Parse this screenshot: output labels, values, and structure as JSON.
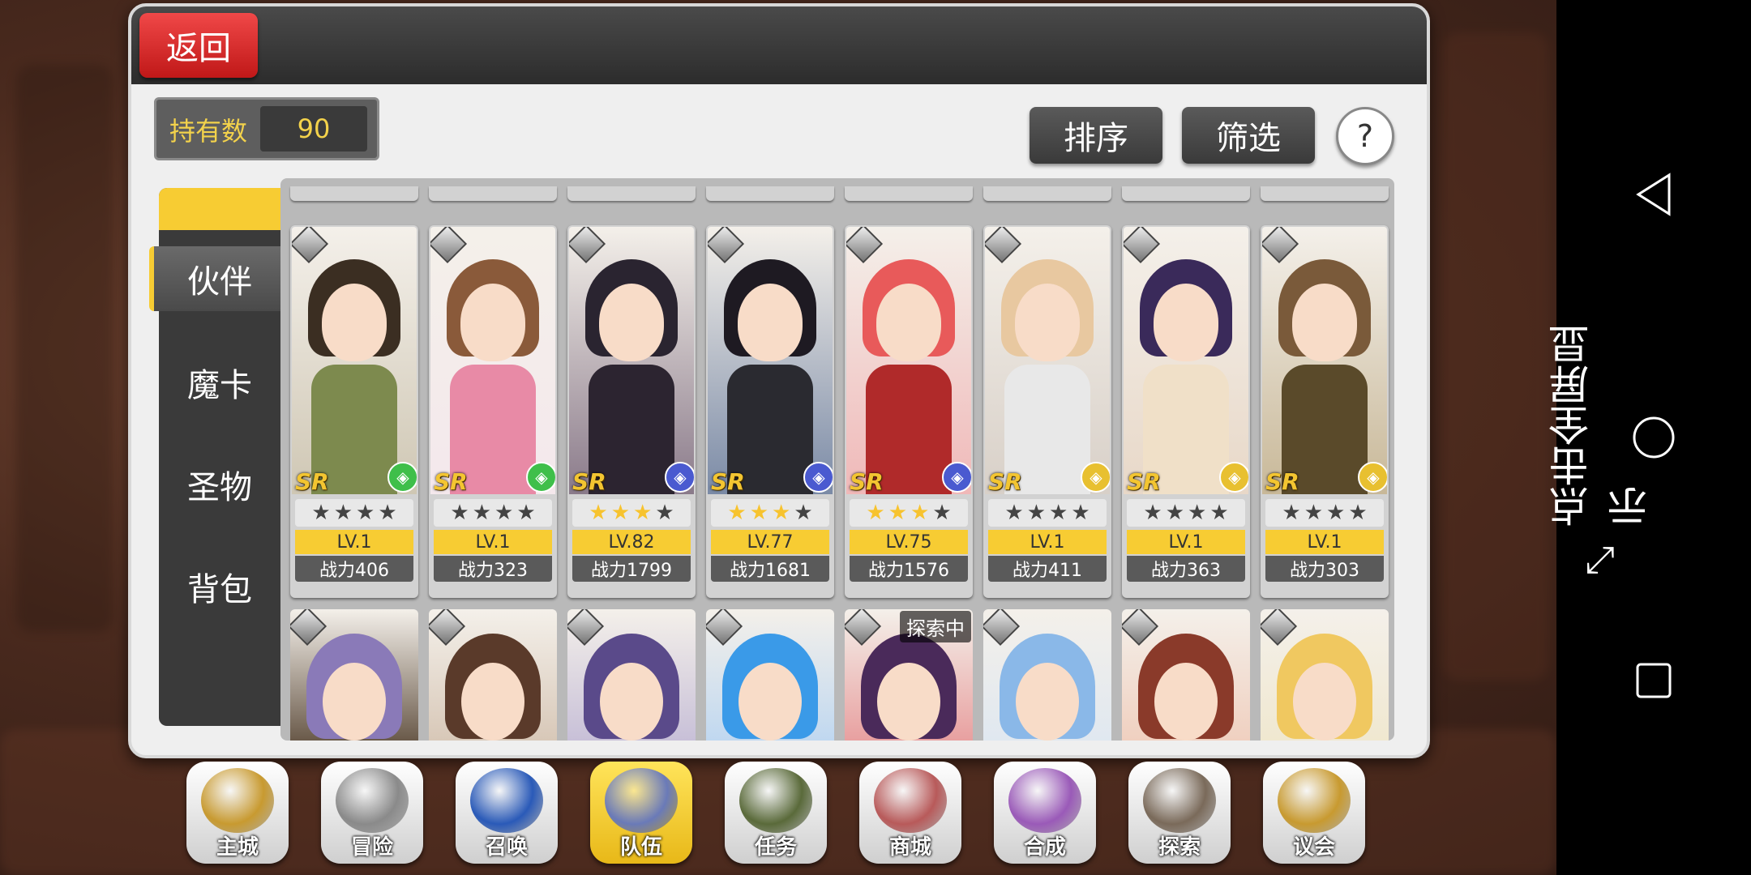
{
  "header": {
    "back_label": "返回"
  },
  "inventory": {
    "count_label": "持有数",
    "count_value": "90"
  },
  "toolbar": {
    "sort_label": "排序",
    "filter_label": "筛选",
    "help_label": "?"
  },
  "side_nav": {
    "items": [
      {
        "label": "伙伴",
        "active": true
      },
      {
        "label": "魔卡",
        "active": false
      },
      {
        "label": "圣物",
        "active": false
      },
      {
        "label": "背包",
        "active": false
      }
    ]
  },
  "cards": [
    {
      "rarity": "SR",
      "stars": 0,
      "level": "LV.1",
      "power": "战力406",
      "hair": "#3b2e22",
      "outfit": "#7d8a4e",
      "bg": "#cfc7b4",
      "type_color": "#3fbf4a",
      "type_icon": "bow-icon"
    },
    {
      "rarity": "SR",
      "stars": 0,
      "level": "LV.1",
      "power": "战力323",
      "hair": "#8a5a3a",
      "outfit": "#e88aa6",
      "bg": "#f4e8ec",
      "type_color": "#3fbf4a",
      "type_icon": "bow-icon"
    },
    {
      "rarity": "SR",
      "stars": 3,
      "level": "LV.82",
      "power": "战力1799",
      "hair": "#2a2430",
      "outfit": "#2c2430",
      "bg": "#8a7a8a",
      "type_color": "#4a5ad0",
      "type_icon": "shield-icon"
    },
    {
      "rarity": "SR",
      "stars": 3,
      "level": "LV.77",
      "power": "战力1681",
      "hair": "#1e1a22",
      "outfit": "#2a2a30",
      "bg": "#7a8aa6",
      "type_color": "#4a5ad0",
      "type_icon": "staff-icon"
    },
    {
      "rarity": "SR",
      "stars": 3,
      "level": "LV.75",
      "power": "战力1576",
      "hair": "#e85a5a",
      "outfit": "#b02a2a",
      "bg": "#f0b8b8",
      "type_color": "#4a5ad0",
      "type_icon": "scythe-icon"
    },
    {
      "rarity": "SR",
      "stars": 0,
      "level": "LV.1",
      "power": "战力411",
      "hair": "#e8c8a0",
      "outfit": "#e8e8e8",
      "bg": "#d8d0c8",
      "type_color": "#e8c030",
      "type_icon": "fist-icon"
    },
    {
      "rarity": "SR",
      "stars": 0,
      "level": "LV.1",
      "power": "战力363",
      "hair": "#3a2a5a",
      "outfit": "#f0e0c8",
      "bg": "#e8d8c8",
      "type_color": "#e8c030",
      "type_icon": "sword-icon"
    },
    {
      "rarity": "SR",
      "stars": 0,
      "level": "LV.1",
      "power": "战力303",
      "hair": "#7a5a3a",
      "outfit": "#5a4a2a",
      "bg": "#c8b898",
      "type_color": "#e8c030",
      "type_icon": "shield-icon"
    }
  ],
  "cards_row2": [
    {
      "hair": "#8a7ab8",
      "bg": "#6a5a4a",
      "tag": ""
    },
    {
      "hair": "#5a3a2a",
      "bg": "#d8c8b8",
      "tag": ""
    },
    {
      "hair": "#5a4a8a",
      "bg": "#c8c0d8",
      "tag": ""
    },
    {
      "hair": "#3a9ae8",
      "bg": "#c0d8f0",
      "tag": ""
    },
    {
      "hair": "#4a2a5a",
      "bg": "#e8a0a0",
      "tag": "探索中"
    },
    {
      "hair": "#8ab8e8",
      "bg": "#e0e8f0",
      "tag": ""
    },
    {
      "hair": "#8a3a2a",
      "bg": "#f0d0c0",
      "tag": ""
    },
    {
      "hair": "#f0c860",
      "bg": "#f0e8d0",
      "tag": ""
    }
  ],
  "bottom_nav": [
    {
      "label": "主城",
      "icon": "crown-icon",
      "color": "#c89a30"
    },
    {
      "label": "冒险",
      "icon": "crossed-swords-icon",
      "color": "#8a8a8a"
    },
    {
      "label": "召唤",
      "icon": "summon-card-icon",
      "color": "#2a5ab8"
    },
    {
      "label": "队伍",
      "icon": "winged-emblem-icon",
      "color": "#6a7ab8",
      "active": true
    },
    {
      "label": "任务",
      "icon": "quest-book-icon",
      "color": "#5a6a3a"
    },
    {
      "label": "商城",
      "icon": "shop-tree-icon",
      "color": "#b85a5a"
    },
    {
      "label": "合成",
      "icon": "potion-icon",
      "color": "#9a5ab8"
    },
    {
      "label": "探索",
      "icon": "explore-bow-icon",
      "color": "#7a6a5a"
    },
    {
      "label": "议会",
      "icon": "council-crest-icon",
      "color": "#c89a30"
    }
  ],
  "system": {
    "fullscreen_tip": "点击全屏显示"
  }
}
